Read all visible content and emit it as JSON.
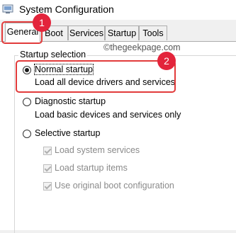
{
  "window": {
    "title": "System Configuration",
    "icon": "system-config-icon"
  },
  "tabs": [
    "General",
    "Boot",
    "Services",
    "Startup",
    "Tools"
  ],
  "watermark": "©thegeekpage.com",
  "startup_selection": {
    "label": "Startup selection",
    "normal": {
      "label": "Normal startup",
      "description": "Load all device drivers and services",
      "selected": true
    },
    "diagnostic": {
      "label": "Diagnostic startup",
      "description": "Load basic devices and services only",
      "selected": false
    },
    "selective": {
      "label": "Selective startup",
      "selected": false,
      "options": [
        {
          "label": "Load system services",
          "checked": true,
          "enabled": false
        },
        {
          "label": "Load startup items",
          "checked": true,
          "enabled": false
        },
        {
          "label": "Use original boot configuration",
          "checked": true,
          "enabled": false
        }
      ]
    }
  },
  "annotations": {
    "badge1": "1",
    "badge2": "2",
    "color": "#e23b3b"
  }
}
